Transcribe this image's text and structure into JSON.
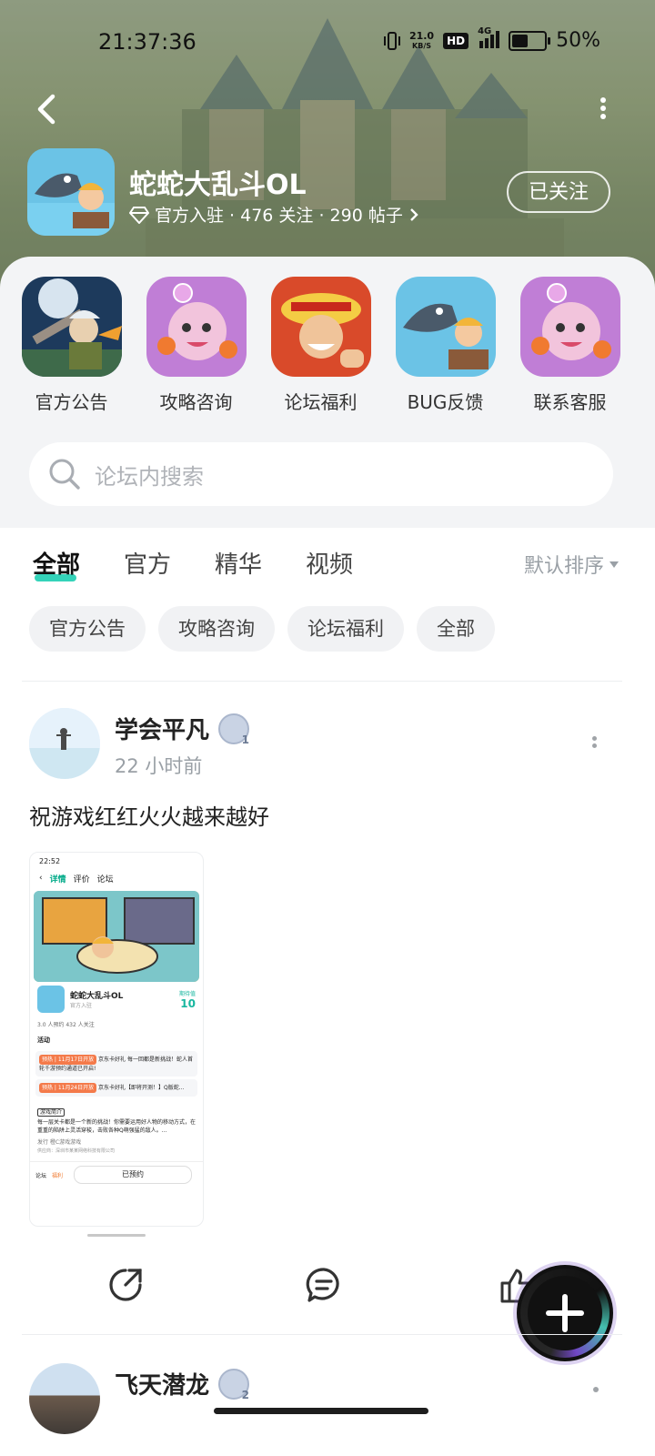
{
  "status_bar": {
    "time": "21:37:36",
    "net_speed": "21.0",
    "net_unit": "KB/S",
    "hd": "HD",
    "signal": "4G",
    "battery": "50%",
    "battery_level": 0.5
  },
  "header": {
    "game_name": "蛇蛇大乱斗OL",
    "meta": "官方入驻 · 476 关注 · 290 帖子",
    "follow_label": "已关注"
  },
  "categories": [
    {
      "label": "官方公告",
      "icon": "sword-hero-icon"
    },
    {
      "label": "攻略咨询",
      "icon": "pink-mascot-icon"
    },
    {
      "label": "论坛福利",
      "icon": "straw-hat-icon"
    },
    {
      "label": "BUG反馈",
      "icon": "fish-hero-icon"
    },
    {
      "label": "联系客服",
      "icon": "pink-mascot-icon"
    }
  ],
  "search": {
    "placeholder": "论坛内搜索"
  },
  "tabs": [
    {
      "label": "全部",
      "active": true
    },
    {
      "label": "官方",
      "active": false
    },
    {
      "label": "精华",
      "active": false
    },
    {
      "label": "视频",
      "active": false
    }
  ],
  "sort_label": "默认排序",
  "chips": [
    "官方公告",
    "攻略咨询",
    "论坛福利",
    "全部"
  ],
  "post": {
    "author": "学会平凡",
    "level": "1",
    "time": "22 小时前",
    "text": "祝游戏红红火火越来越好",
    "screenshot": {
      "time": "22:52",
      "nav": [
        "详情",
        "评价",
        "论坛"
      ],
      "game_name": "蛇蛇大乱斗OL",
      "official": "官方入驻",
      "score_label": "期待值",
      "score": "10",
      "stats": "3.0 人预约    432 人关注",
      "activity_title": "活动",
      "activity_1_tag": "预热 | 11月17日开放",
      "activity_1_text": "京东卡好礼 每一回都是新挑战！蛇人首轮千游预约通道已开启!",
      "activity_2_tag": "预热 | 11月24日开放",
      "activity_2_text": "京东卡好礼【即将开测！】Q版蛇...",
      "intro_tag": "游戏简介",
      "intro_text": "每一层关卡都是一个新的挑战！你需要运用好人物的移动方式，在重重的陷阱上灵活穿梭，击败各种Q萌强猛的敌人。...",
      "publisher_line": "发行  橙C游戏游戏",
      "company_line": "供应商：深圳市某某网络科技有限公司",
      "bottom_labels": [
        "论坛",
        "福利"
      ],
      "reserve_label": "已预约"
    }
  },
  "next_post": {
    "author": "飞天潜龙",
    "level": "2"
  }
}
